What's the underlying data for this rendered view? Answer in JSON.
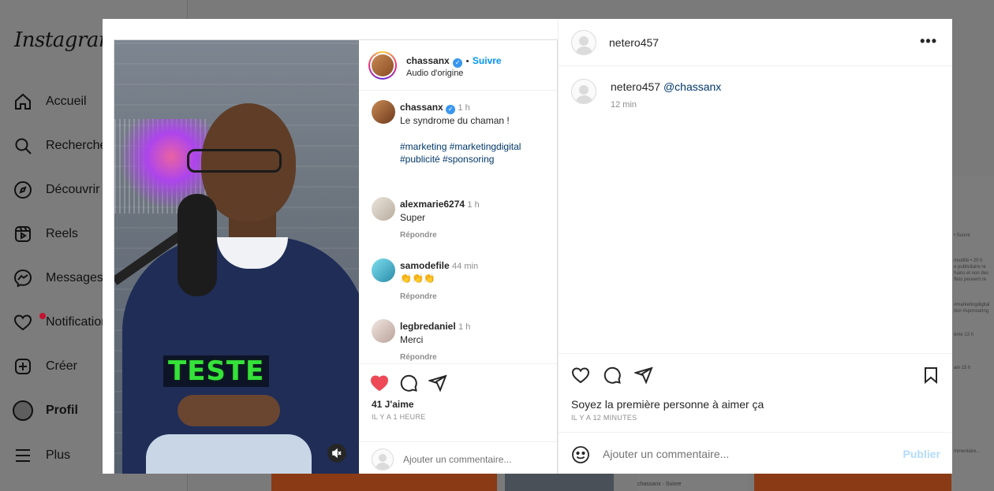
{
  "background": {
    "logo": "Instagram",
    "nav": [
      {
        "label": "Accueil",
        "icon": "home-icon"
      },
      {
        "label": "Recherche",
        "icon": "search-icon"
      },
      {
        "label": "Découvrir",
        "icon": "compass-icon"
      },
      {
        "label": "Reels",
        "icon": "reels-icon"
      },
      {
        "label": "Messages",
        "icon": "messenger-icon"
      },
      {
        "label": "Notifications",
        "icon": "heart-icon"
      },
      {
        "label": "Créer",
        "icon": "plus-square-icon"
      },
      {
        "label": "Profil",
        "icon": "avatar"
      },
      {
        "label": "Plus",
        "icon": "menu-icon"
      }
    ],
    "right_fragments": [
      "• Suivre",
      "modifié • 20 h",
      "e publicitaire re",
      "hains et non des",
      "ffets peuvent re",
      "#marketingdigital",
      "tion #sponsoring",
      "ème 13 h",
      "ain 15 h"
    ],
    "bottom_fragment_user": "chassanx",
    "bottom_fragment_follow": "Suivre",
    "bottom_fragment_comment": "mmentaire..."
  },
  "reel": {
    "author": "chassanx",
    "follow": "Suivre",
    "separator": "•",
    "audio": "Audio d'origine",
    "caption_time": "1 h",
    "caption": "Le syndrome du chaman !",
    "hashtags_line1": "#marketing #marketingdigital",
    "hashtags_line2": "#publicité #sponsoring",
    "overlay_text": "TESTE",
    "comments": [
      {
        "user": "alexmarie6274",
        "time": "1 h",
        "text": "Super",
        "reply": "Répondre"
      },
      {
        "user": "samodefile",
        "time": "44 min",
        "text": "👏👏👏",
        "reply": "Répondre"
      },
      {
        "user": "legbredaniel",
        "time": "1 h",
        "text": "Merci",
        "reply": "Répondre"
      }
    ],
    "likes": "41 J'aime",
    "posted": "IL Y A 1 HEURE",
    "comment_placeholder": "Ajouter un commentaire..."
  },
  "post": {
    "author": "netero457",
    "caption_user": "netero457",
    "caption_mention": "@chassanx",
    "caption_time": "12 min",
    "more": "•••",
    "likes_text": "Soyez la première personne à aimer ça",
    "posted": "IL Y A 12 MINUTES",
    "comment_placeholder": "Ajouter un commentaire...",
    "publish": "Publier"
  }
}
